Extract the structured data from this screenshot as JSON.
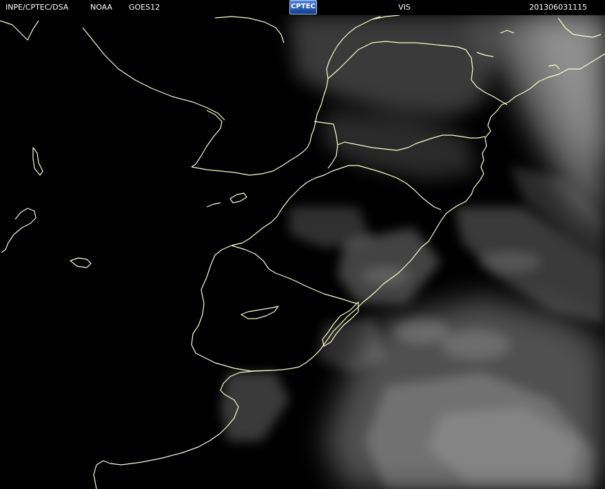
{
  "header": {
    "agency": "INPE/CPTEC/DSA",
    "provider": "NOAA",
    "satellite": "GOES12",
    "channel": "VIS",
    "timestamp": "201306031115"
  },
  "logo": {
    "text": "CPTEC"
  },
  "map": {
    "background_color": "#000000",
    "coastline_color": "#ffffd0",
    "cloud_color": "#bfbfbf"
  }
}
